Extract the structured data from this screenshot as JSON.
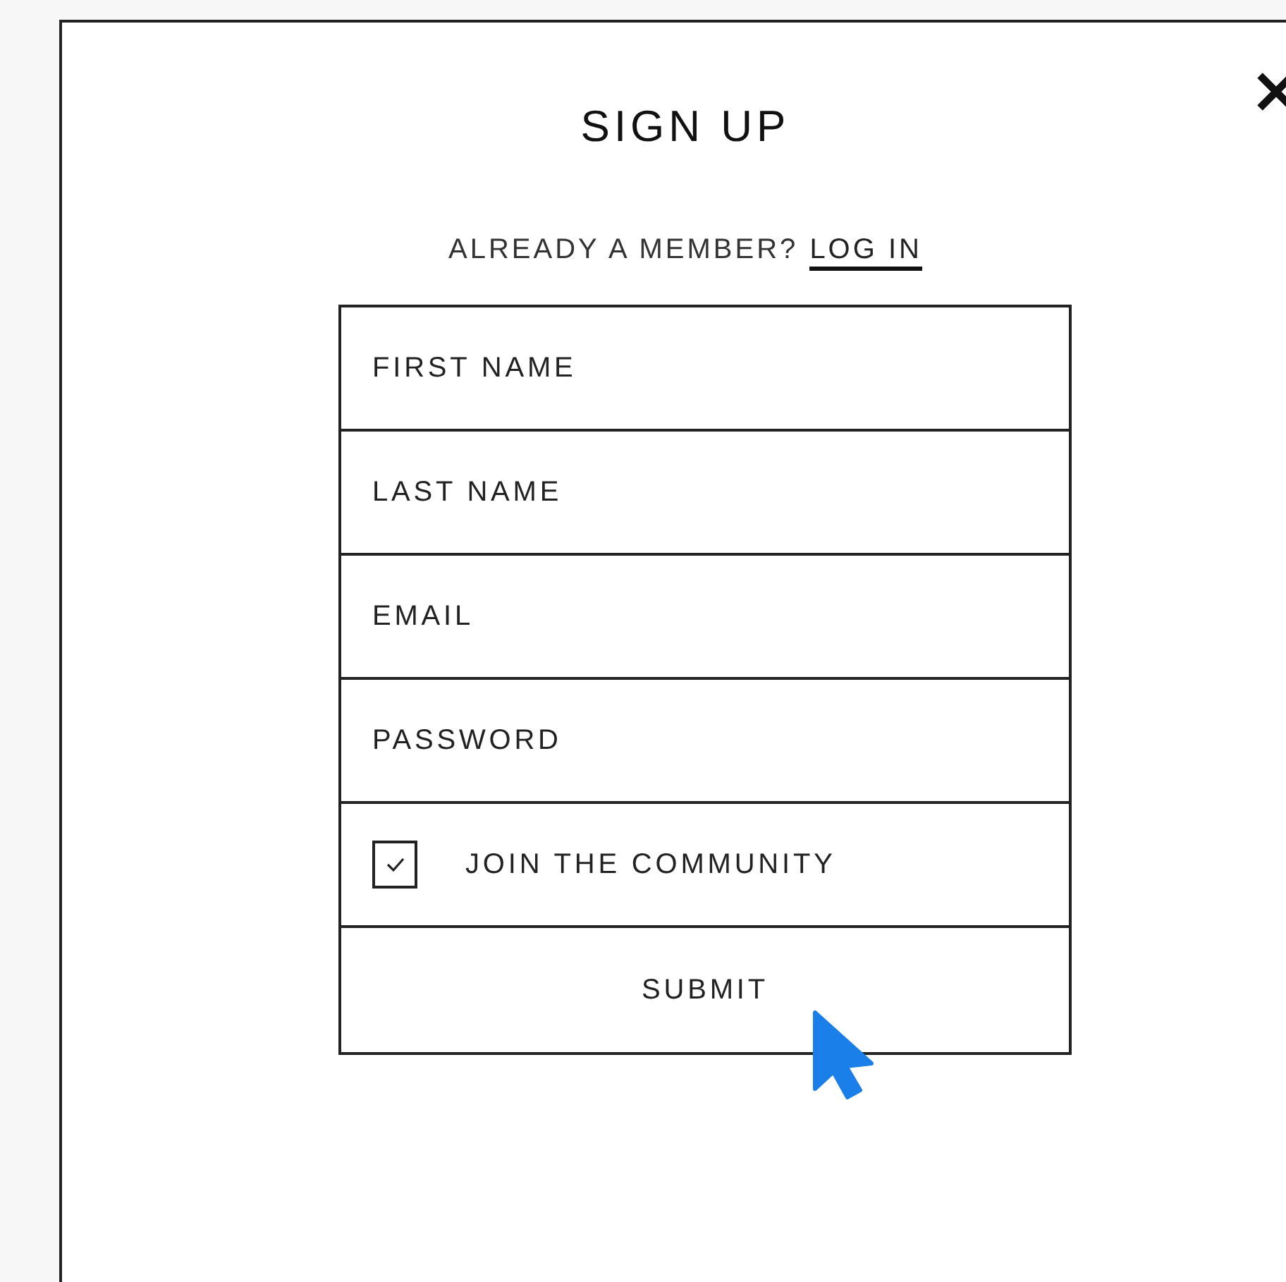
{
  "dialog": {
    "title": "SIGN UP",
    "login_prompt": "ALREADY A MEMBER?",
    "login_link": "LOG IN"
  },
  "fields": [
    {
      "placeholder": "FIRST NAME"
    },
    {
      "placeholder": "LAST NAME"
    },
    {
      "placeholder": "EMAIL"
    },
    {
      "placeholder": "PASSWORD"
    }
  ],
  "checkbox": {
    "label": "JOIN THE COMMUNITY",
    "checked": true
  },
  "buttons": [
    "SUBMIT"
  ]
}
